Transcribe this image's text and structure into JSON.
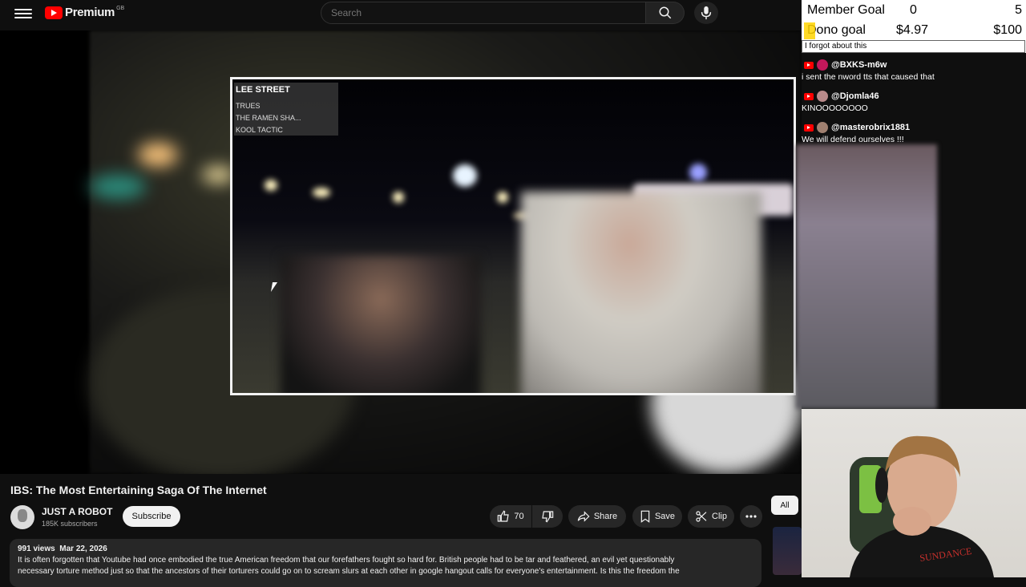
{
  "app": {
    "brand": "Premium",
    "region": "GB"
  },
  "search": {
    "placeholder": "Search"
  },
  "player": {
    "overlay": {
      "title": "LEE STREET",
      "items": [
        "TRUES",
        "THE RAMEN SHA...",
        "KOOL TACTIC"
      ]
    }
  },
  "video": {
    "title": "IBS: The Most Entertaining Saga Of The Internet",
    "channel": "JUST A ROBOT",
    "subscribers": "185K subscribers",
    "subscribe_label": "Subscribe",
    "likes": "70",
    "share_label": "Share",
    "save_label": "Save",
    "clip_label": "Clip",
    "views": "991 views",
    "date": "Mar 22, 2026",
    "description_line1": "It is often forgotten that Youtube had once embodied the true American freedom that our forefathers fought so hard for. British people had to be tar and feathered, an evil yet questionably",
    "description_line2": "necessary torture method just so that the ancestors of their torturers could go on to scream slurs at each other in google hangout calls for everyone's entertainment. Is this the freedom the"
  },
  "chips": {
    "all": "All"
  },
  "goals": {
    "member_label": "Member Goal",
    "member_current": "0",
    "member_target": "5",
    "dono_label": "Dono goal",
    "dono_current": "$4.97",
    "dono_target": "$100",
    "comment": "I forgot about this"
  },
  "chat": [
    {
      "user": "@BXKS-m6w",
      "text": "i sent the nword tts that caused that",
      "avatar_color": "#c2185b"
    },
    {
      "user": "@Djomla46",
      "text": "KINOOOOOOOO",
      "avatar_color": "#b98a8a"
    },
    {
      "user": "@masterobrix1881",
      "text": "We will defend ourselves !!!",
      "avatar_color": "#a08070"
    }
  ],
  "webcam": {
    "shirt_text": "SUNDANCE"
  },
  "colors": {
    "accent": "#ff0000",
    "dono_highlight": "#ffd400"
  }
}
